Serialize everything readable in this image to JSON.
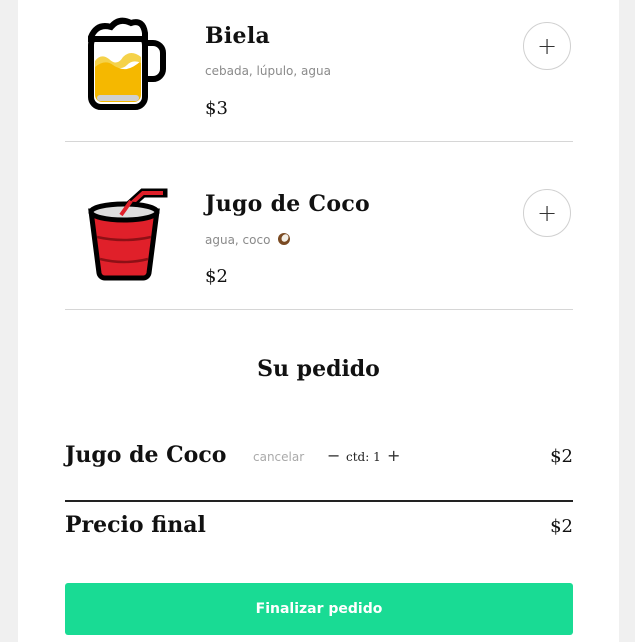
{
  "menu": {
    "items": [
      {
        "name": "Biela",
        "ingredients": "cebada, lúpulo, agua",
        "price": "$3",
        "icon": "beer-mug-icon",
        "add_label": "+"
      },
      {
        "name": "Jugo de Coco",
        "ingredients": "agua, coco",
        "ingredients_icon": "coconut-icon",
        "price": "$2",
        "icon": "cup-with-straw-icon",
        "add_label": "+"
      }
    ]
  },
  "order": {
    "title": "Su pedido",
    "lines": [
      {
        "name": "Jugo de Coco",
        "cancel_label": "cancelar",
        "minus_label": "−",
        "qty_label": "ctd: 1",
        "plus_label": "+",
        "price": "$2"
      }
    ],
    "total_label": "Precio final",
    "total_price": "$2",
    "checkout_label": "Finalizar pedido"
  },
  "colors": {
    "accent": "#19db94",
    "beer": "#f5b800",
    "cup": "#e0202a"
  }
}
